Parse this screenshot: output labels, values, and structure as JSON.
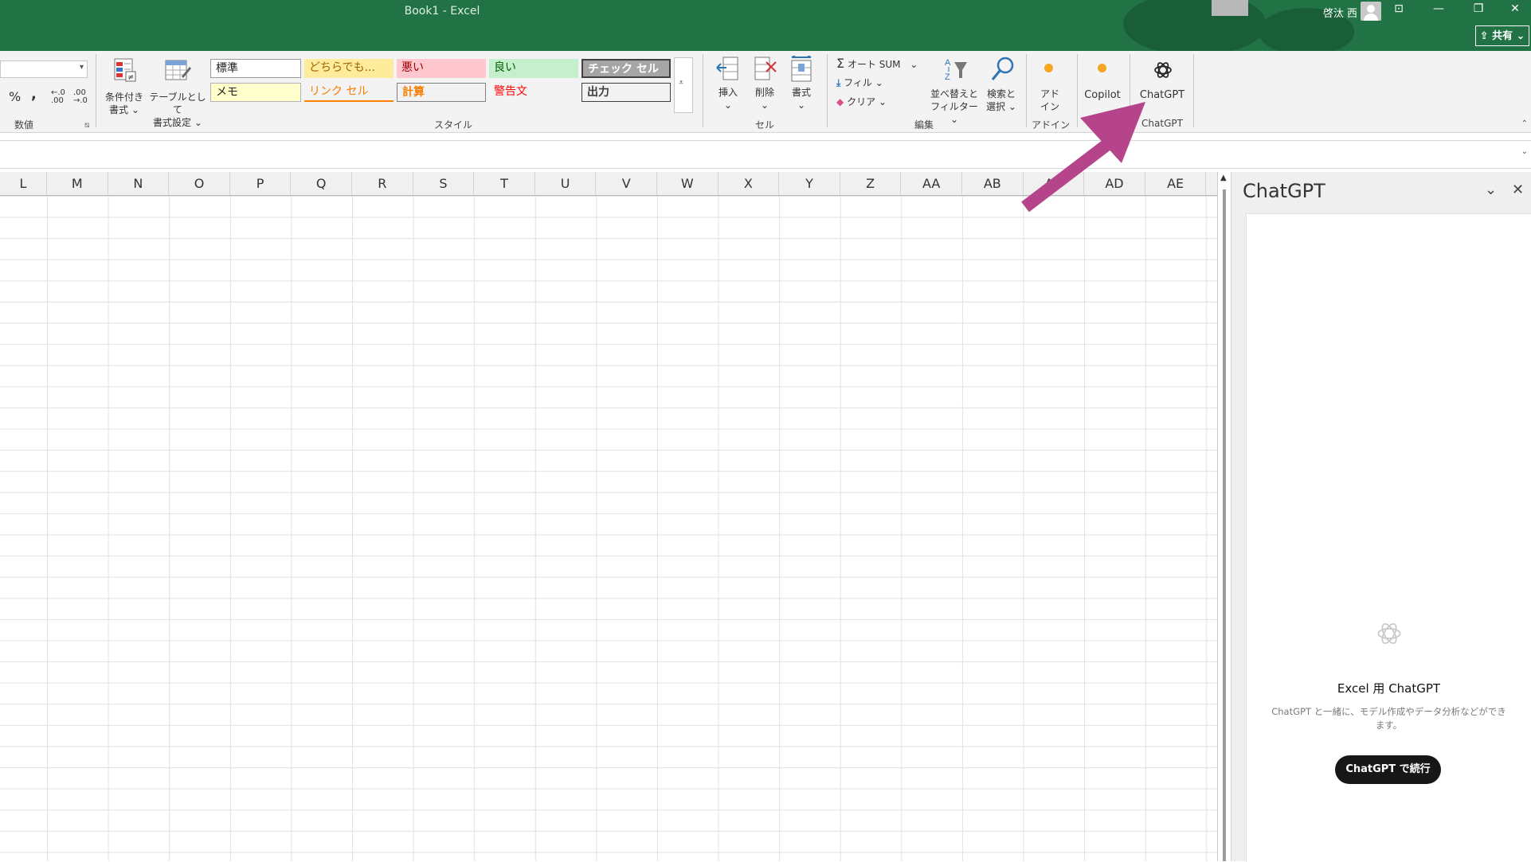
{
  "window": {
    "title": "Book1  -  Excel",
    "user_name": "啓汰 西",
    "share_label": "共有"
  },
  "ribbon": {
    "number_group": {
      "label": "数値",
      "percent": "%",
      "comma": "'",
      "increase_decimal": "←.0\n.00",
      "decrease_decimal": ".00\n→.0"
    },
    "conditional_format": {
      "line1": "条件付き",
      "line2": "書式"
    },
    "format_as_table": {
      "line1": "テーブルとして",
      "line2": "書式設定"
    },
    "styles_group_label": "スタイル",
    "styles": {
      "normal": "標準",
      "neutral": "どちらでも...",
      "bad": "悪い",
      "good": "良い",
      "check_cell": "チェック セル",
      "note": "メモ",
      "link_cell": "リンク セル",
      "calculation": "計算",
      "warning": "警告文",
      "output": "出力"
    },
    "cells_group": {
      "label": "セル",
      "insert": "挿入",
      "delete": "削除",
      "format": "書式"
    },
    "editing_group": {
      "label": "編集",
      "autosum": "オート SUM",
      "fill": "フィル",
      "clear": "クリア",
      "sort_filter_1": "並べ替えと",
      "sort_filter_2": "フィルター",
      "find_select_1": "検索と",
      "find_select_2": "選択"
    },
    "addins_group": {
      "label": "アドイン",
      "line1": "アド",
      "line2": "イン"
    },
    "copilot": {
      "label": "Copilot"
    },
    "chatgpt_group": {
      "label": "ChatGPT",
      "button": "ChatGPT"
    }
  },
  "columns": [
    "L",
    "M",
    "N",
    "O",
    "P",
    "Q",
    "R",
    "S",
    "T",
    "U",
    "V",
    "W",
    "X",
    "Y",
    "Z",
    "AA",
    "AB",
    "AC",
    "AD",
    "AE"
  ],
  "task_pane": {
    "title": "ChatGPT",
    "heading": "Excel 用 ChatGPT",
    "description": "ChatGPT と一緒に、モデル作成やデータ分析などができます。",
    "cta": "ChatGPT で続行"
  },
  "colors": {
    "excel_green": "#217346",
    "arrow": "#b5448a"
  }
}
